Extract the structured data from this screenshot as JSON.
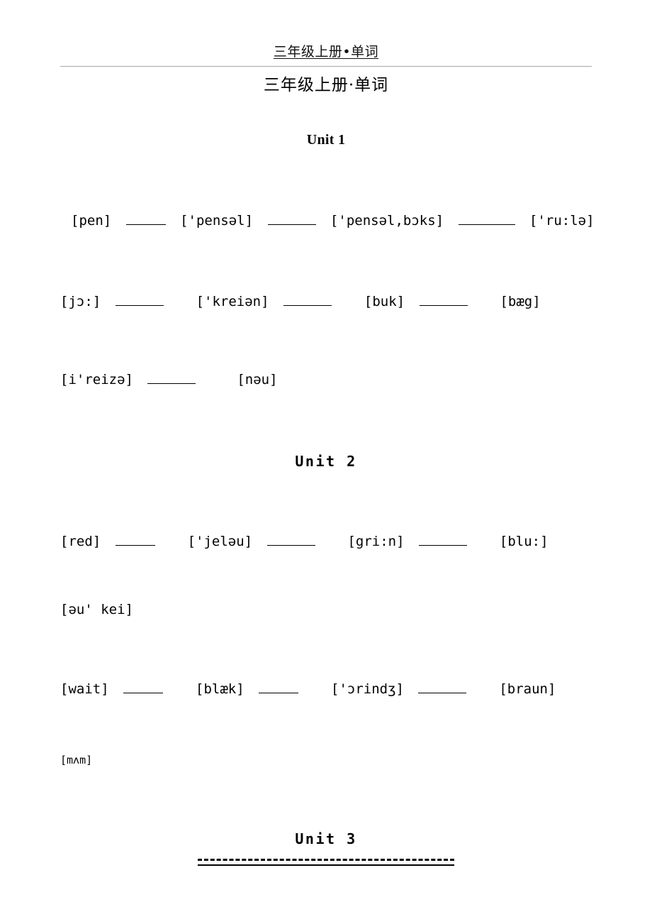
{
  "header": {
    "running_title": "三年级上册•单词"
  },
  "title": "三年级上册·单词",
  "units": [
    {
      "heading": "Unit 1"
    },
    {
      "heading": "Unit 2"
    },
    {
      "heading": "Unit 3"
    }
  ],
  "unit1": {
    "row1": {
      "w1": "[pen]",
      "w2": "['pensəl]",
      "w3": "['pensəl,bɔks]",
      "w4": "['ru:lə]"
    },
    "row2": {
      "w1": "[jɔ:]",
      "w2": "['kreiən]",
      "w3": "[buk]",
      "w4": "[bæg]"
    },
    "row3": {
      "w1": "[i'reizə]",
      "w2": "[nəu]"
    }
  },
  "unit2": {
    "row1": {
      "w1": "[red]",
      "w2": "['jeləu]",
      "w3": "[gri:n]",
      "w4": "[blu:]"
    },
    "row2": {
      "w1": "[əu' kei]"
    },
    "row3": {
      "w1": "[wait]",
      "w2": "[blæk]",
      "w3": "['ɔrindʒ]",
      "w4": "[braun]"
    },
    "row4": {
      "w1": "[mʌm]"
    }
  }
}
